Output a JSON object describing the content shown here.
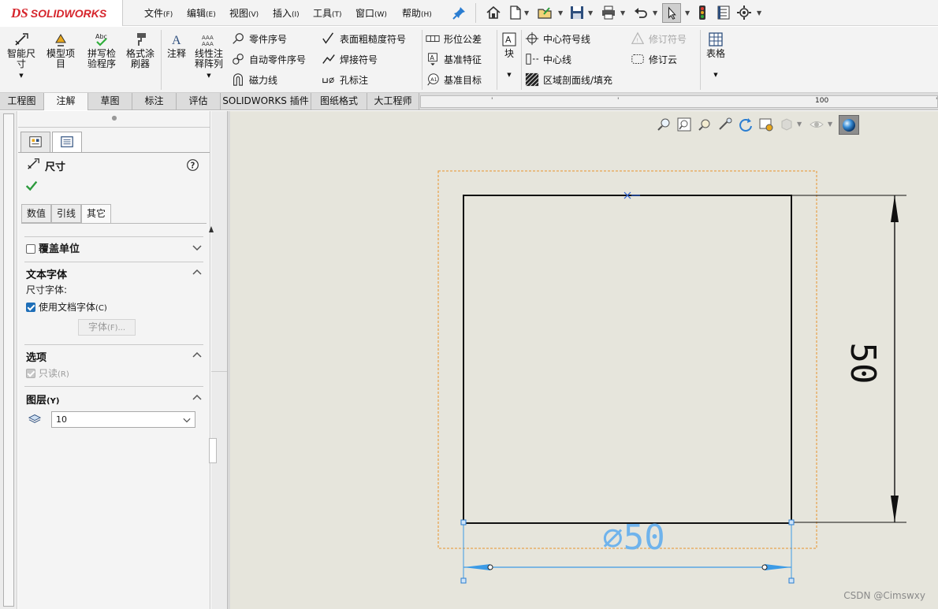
{
  "app": {
    "brand": "SOLIDWORKS",
    "brand_mark": "DS"
  },
  "menu": [
    {
      "label": "文件",
      "key": "(F)"
    },
    {
      "label": "编辑",
      "key": "(E)"
    },
    {
      "label": "视图",
      "key": "(V)"
    },
    {
      "label": "插入",
      "key": "(I)"
    },
    {
      "label": "工具",
      "key": "(T)"
    },
    {
      "label": "窗口",
      "key": "(W)"
    },
    {
      "label": "帮助",
      "key": "(H)"
    }
  ],
  "ribbon": {
    "smart_dim": "智能尺寸",
    "model_items": "模型项目",
    "spell_check": "拼写检验程序",
    "format_painter": "格式涂刷器",
    "note": "注释",
    "linear_pattern": "线性注释阵列",
    "balloon": "零件序号",
    "auto_balloon": "自动零件序号",
    "magnetic_line": "磁力线",
    "surface_finish": "表面粗糙度符号",
    "weld_symbol": "焊接符号",
    "hole_callout": "孔标注",
    "gtol": "形位公差",
    "datum_feature": "基准特征",
    "datum_target": "基准目标",
    "block": "块",
    "centermark": "中心符号线",
    "centerline": "中心线",
    "hatch": "区域剖面线/填充",
    "revision_symbol": "修订符号",
    "revision_cloud": "修订云",
    "table": "表格"
  },
  "tabs": [
    "工程图",
    "注解",
    "草图",
    "标注",
    "评估",
    "SOLIDWORKS 插件",
    "图纸格式",
    "大工程师"
  ],
  "active_tab": 1,
  "ruler": {
    "mark": "100"
  },
  "pm": {
    "title": "尺寸",
    "subtabs": [
      "数值",
      "引线",
      "其它"
    ],
    "active_subtab": 2,
    "override_units": "覆盖单位",
    "text_font": "文本字体",
    "dim_font": "尺寸字体:",
    "use_doc_font": "使用文档字体",
    "use_doc_font_key": "(C)",
    "font_button": "字体",
    "font_button_key": "(F)...",
    "options": "选项",
    "readonly": "只读",
    "readonly_key": "(R)",
    "layer": "图层",
    "layer_key": "(Y)",
    "layer_value": "10"
  },
  "drawing": {
    "diameter_dim": "⌀50",
    "vertical_dim": "50"
  },
  "colors": {
    "brand": "#d6252c",
    "selection": "#3c9be6",
    "canvas": "#e6e5dc",
    "bbox": "#e8922c"
  },
  "watermark": "CSDN @Cimswxy"
}
